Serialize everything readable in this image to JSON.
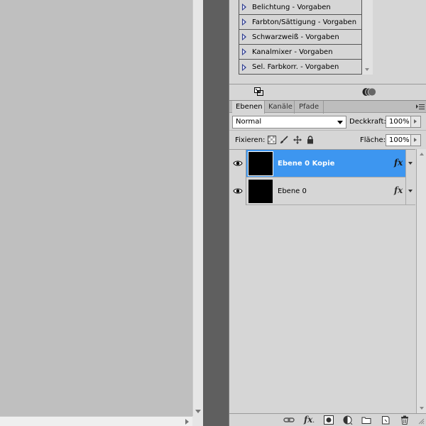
{
  "adjustments": {
    "presets": [
      {
        "label": "Belichtung - Vorgaben"
      },
      {
        "label": "Farbton/Sättigung - Vorgaben"
      },
      {
        "label": "Schwarzweiß - Vorgaben"
      },
      {
        "label": "Kanalmixer - Vorgaben"
      },
      {
        "label": "Sel. Farbkorr. - Vorgaben"
      }
    ]
  },
  "tabs": [
    {
      "label": "Ebenen",
      "active": true
    },
    {
      "label": "Kanäle",
      "active": false
    },
    {
      "label": "Pfade",
      "active": false
    }
  ],
  "layers_panel": {
    "blend_mode": "Normal",
    "opacity_label": "Deckkraft:",
    "opacity_value": "100%",
    "lock_label": "Fixieren:",
    "fill_label": "Fläche:",
    "fill_value": "100%",
    "layers": [
      {
        "name": "Ebene 0 Kopie",
        "selected": true,
        "visible": true,
        "has_fx": true
      },
      {
        "name": "Ebene 0",
        "selected": false,
        "visible": true,
        "has_fx": true
      }
    ]
  },
  "colors": {
    "selection": "#3d96f0",
    "canvas_bg": "#bfbfbf",
    "panel_bg": "#d6d6d6",
    "workspace_bg": "#5f5f5f"
  },
  "icons": {
    "preset_item": "triangle-play-icon",
    "layer_visibility": "eye-icon",
    "layer_effects": "fx-icon",
    "toolbar": [
      "link-icon",
      "fx-icon",
      "mask-icon",
      "adjustment-layer-icon",
      "group-icon",
      "new-layer-icon",
      "trash-icon"
    ]
  }
}
